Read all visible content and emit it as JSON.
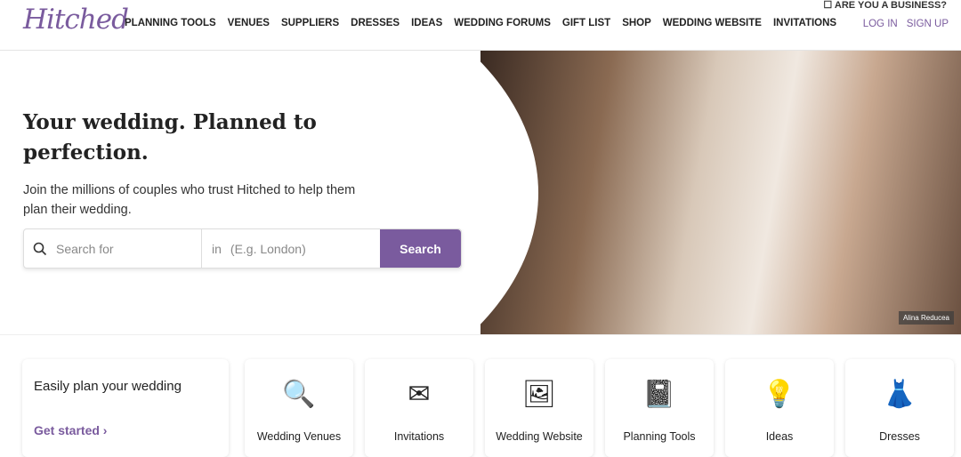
{
  "header": {
    "logo": "Hitched",
    "business": "☐ ARE YOU A BUSINESS?",
    "nav": [
      "PLANNING TOOLS",
      "VENUES",
      "SUPPLIERS",
      "DRESSES",
      "IDEAS",
      "WEDDING FORUMS",
      "GIFT LIST",
      "SHOP",
      "WEDDING WEBSITE",
      "INVITATIONS"
    ],
    "login": "LOG IN",
    "signup": "SIGN UP"
  },
  "hero": {
    "title": "Your wedding. Planned to perfection.",
    "subtitle": "Join the millions of couples who trust Hitched to help them plan their wedding.",
    "search_placeholder": "Search for",
    "location_prefix": "in",
    "location_placeholder": "(E.g. London)",
    "search_button": "Search",
    "photo_credit": "Alina Reducea"
  },
  "plan": {
    "title": "Easily plan your wedding",
    "cta": "Get started ›"
  },
  "categories": [
    {
      "label": "Wedding Venues",
      "icon": "🔍"
    },
    {
      "label": "Invitations",
      "icon": "✉"
    },
    {
      "label": "Wedding Website",
      "icon": "🖼"
    },
    {
      "label": "Planning Tools",
      "icon": "📓"
    },
    {
      "label": "Ideas",
      "icon": "💡"
    },
    {
      "label": "Dresses",
      "icon": "👗"
    }
  ],
  "colors": {
    "brand": "#7a5b9e"
  }
}
